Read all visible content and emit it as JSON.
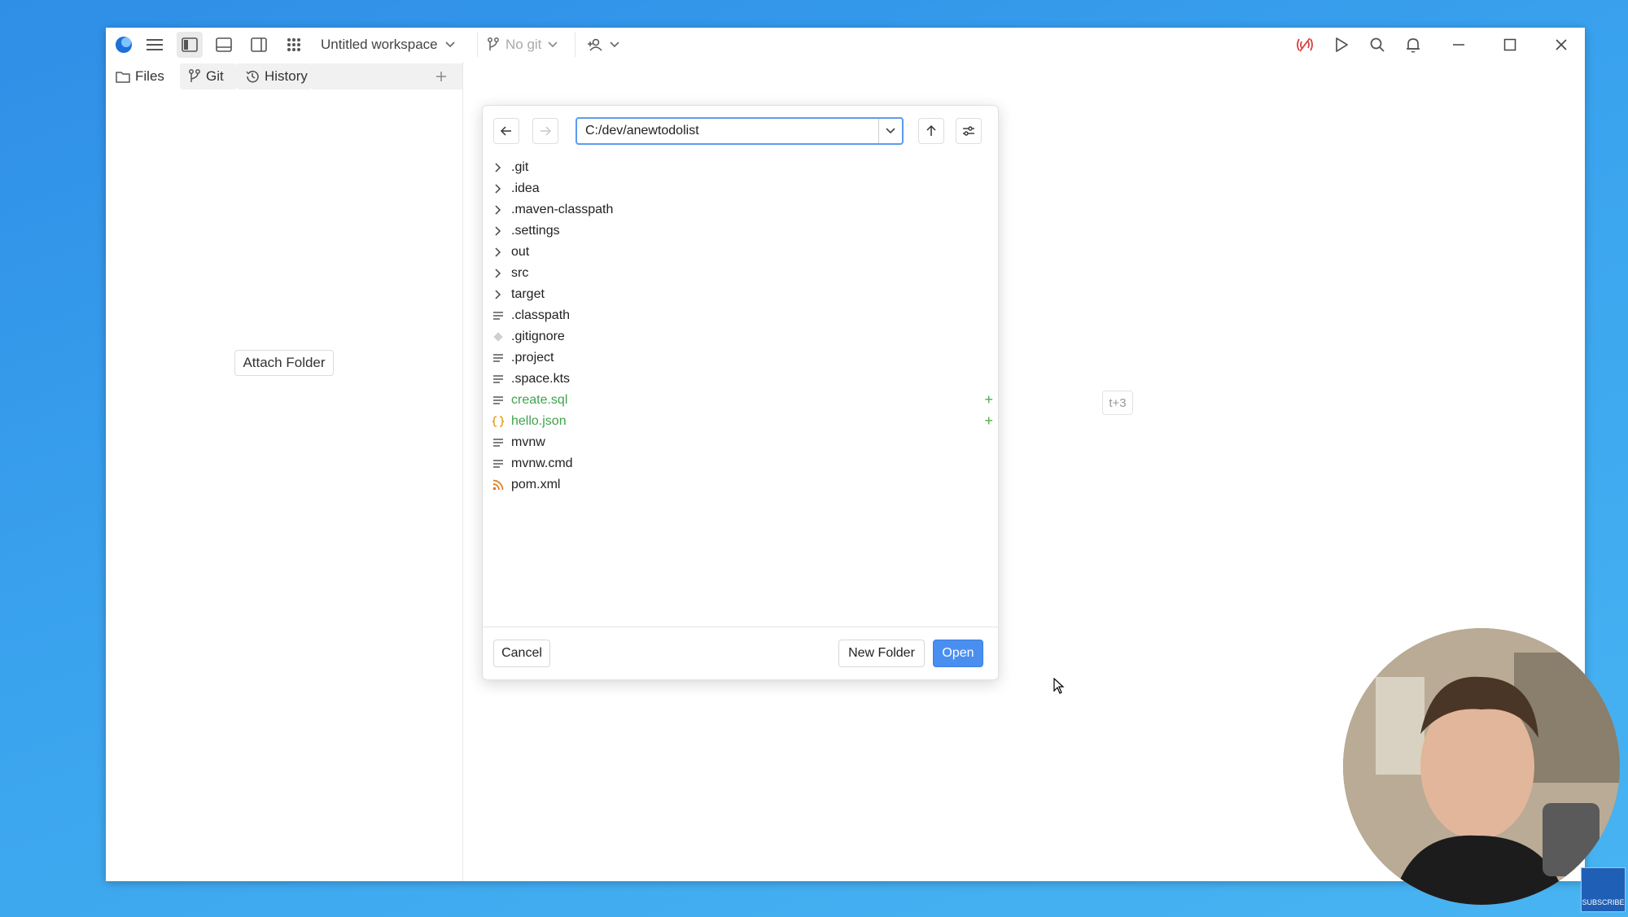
{
  "titlebar": {
    "workspace_label": "Untitled workspace",
    "git_label": "No git"
  },
  "sidebar": {
    "tabs": [
      {
        "label": "Files",
        "icon": "folder-icon"
      },
      {
        "label": "Git",
        "icon": "git-branch-icon"
      },
      {
        "label": "History",
        "icon": "history-icon"
      }
    ],
    "attach_folder_label": "Attach Folder"
  },
  "hint_text": "t+3",
  "dialog": {
    "path_value": "C:/dev/anewtodolist",
    "items": [
      {
        "name": ".git",
        "kind": "folder"
      },
      {
        "name": ".idea",
        "kind": "folder"
      },
      {
        "name": ".maven-classpath",
        "kind": "folder"
      },
      {
        "name": ".settings",
        "kind": "folder"
      },
      {
        "name": "out",
        "kind": "folder"
      },
      {
        "name": "src",
        "kind": "folder"
      },
      {
        "name": "target",
        "kind": "folder"
      },
      {
        "name": ".classpath",
        "kind": "file"
      },
      {
        "name": ".gitignore",
        "kind": "gitignore"
      },
      {
        "name": ".project",
        "kind": "file"
      },
      {
        "name": ".space.kts",
        "kind": "file"
      },
      {
        "name": "create.sql",
        "kind": "file",
        "added": true
      },
      {
        "name": "hello.json",
        "kind": "json",
        "added": true
      },
      {
        "name": "mvnw",
        "kind": "file"
      },
      {
        "name": "mvnw.cmd",
        "kind": "file"
      },
      {
        "name": "pom.xml",
        "kind": "xml"
      }
    ],
    "cancel_label": "Cancel",
    "new_folder_label": "New Folder",
    "open_label": "Open"
  },
  "overlay": {
    "subscribe_label": "SUBSCRIBE"
  },
  "colors": {
    "accent": "#4a8ff0",
    "added": "#3fa34d",
    "desktop": "#3aa3ee"
  }
}
